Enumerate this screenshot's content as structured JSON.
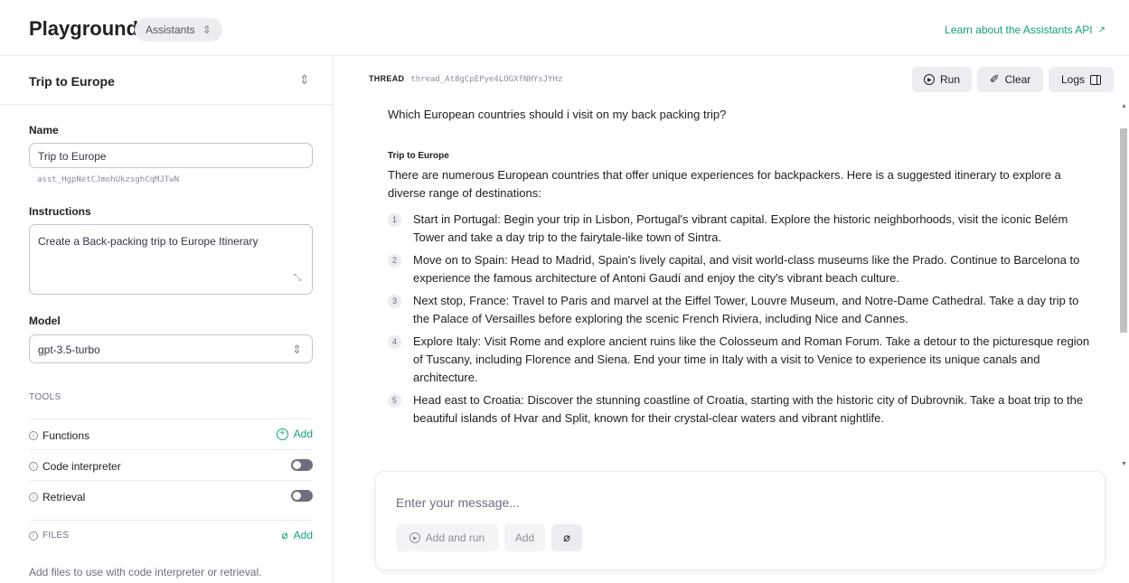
{
  "header": {
    "brand": "Playground",
    "mode": "Assistants",
    "mode_chevron": "⌃⌄",
    "learn_link": "Learn about the Assistants API",
    "learn_arrow": "↗"
  },
  "sidebar": {
    "assistant_selected": "Trip to Europe",
    "name_label": "Name",
    "name_value": "Trip to Europe",
    "assistant_id": "asst_HgpNetCJmohUkzsghCqMJTwN",
    "instructions_label": "Instructions",
    "instructions_value": "Create a Back-packing trip to Europe Itinerary",
    "model_label": "Model",
    "model_value": "gpt-3.5-turbo",
    "tools_label": "TOOLS",
    "tools": [
      {
        "label": "Functions",
        "control": "add",
        "add_label": "Add"
      },
      {
        "label": "Code interpreter",
        "control": "toggle",
        "enabled": false
      },
      {
        "label": "Retrieval",
        "control": "toggle",
        "enabled": false
      }
    ],
    "files_label": "FILES",
    "files_add_label": "Add",
    "files_hint": "Add files to use with code interpreter or retrieval."
  },
  "thread": {
    "label": "THREAD",
    "id": "thread_At8gCpEPye4LOGXfNHYsJYHz",
    "buttons": {
      "run": "Run",
      "clear": "Clear",
      "logs": "Logs"
    },
    "user_message": "Which European countries should i visit on my back packing trip?",
    "assistant_name": "Trip to Europe",
    "assistant_intro": "There are numerous European countries that offer unique experiences for backpackers. Here is a suggested itinerary to explore a diverse range of destinations:",
    "steps": [
      {
        "num": "1",
        "text": "Start in Portugal: Begin your trip in Lisbon, Portugal's vibrant capital. Explore the historic neighborhoods, visit the iconic Belém Tower and take a day trip to the fairytale-like town of Sintra."
      },
      {
        "num": "2",
        "text": "Move on to Spain: Head to Madrid, Spain's lively capital, and visit world-class museums like the Prado. Continue to Barcelona to experience the famous architecture of Antoni Gaudí and enjoy the city's vibrant beach culture."
      },
      {
        "num": "3",
        "text": "Next stop, France: Travel to Paris and marvel at the Eiffel Tower, Louvre Museum, and Notre-Dame Cathedral. Take a day trip to the Palace of Versailles before exploring the scenic French Riviera, including Nice and Cannes."
      },
      {
        "num": "4",
        "text": "Explore Italy: Visit Rome and explore ancient ruins like the Colosseum and Roman Forum. Take a detour to the picturesque region of Tuscany, including Florence and Siena. End your time in Italy with a visit to Venice to experience its unique canals and architecture."
      },
      {
        "num": "5",
        "text": "Head east to Croatia: Discover the stunning coastline of Croatia, starting with the historic city of Dubrovnik. Take a boat trip to the beautiful islands of Hvar and Split, known for their crystal-clear waters and vibrant nightlife."
      }
    ]
  },
  "composer": {
    "placeholder": "Enter your message...",
    "add_and_run": "Add and run",
    "add": "Add"
  },
  "icons": {
    "chevron": "chevron-up-down-icon",
    "info": "info-icon",
    "plus": "plus-circle-icon",
    "paperclip": "paperclip-icon",
    "play": "play-circle-icon",
    "broom": "broom-icon",
    "panel": "panel-icon",
    "resize": "resize-handle-icon"
  },
  "colors": {
    "accent": "#10a37f",
    "text": "#202123",
    "muted": "#8e8ea0",
    "border": "#ececf1",
    "button_bg": "#ececf1"
  }
}
